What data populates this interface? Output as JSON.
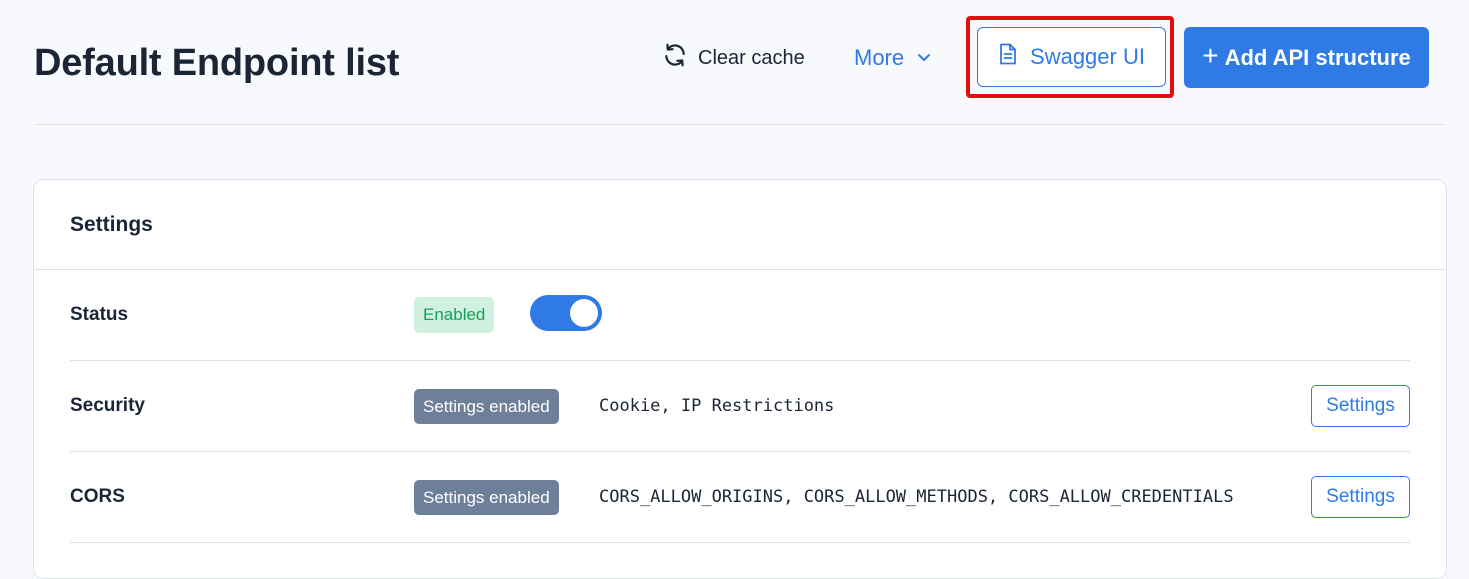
{
  "header": {
    "title": "Default Endpoint list",
    "clear_cache_label": "Clear cache",
    "more_label": "More",
    "swagger_label": "Swagger UI",
    "add_label": "Add API structure",
    "add_prefix": "+"
  },
  "settings": {
    "title": "Settings",
    "status": {
      "label": "Status",
      "badge": "Enabled",
      "toggle_on": true
    },
    "security": {
      "label": "Security",
      "badge": "Settings enabled",
      "value": "Cookie, IP Restrictions",
      "button": "Settings"
    },
    "cors": {
      "label": "CORS",
      "badge": "Settings enabled",
      "value": "CORS_ALLOW_ORIGINS, CORS_ALLOW_METHODS, CORS_ALLOW_CREDENTIALS",
      "button": "Settings"
    }
  },
  "colors": {
    "accent": "#2f7ae5",
    "highlight": "#e01010",
    "enabled_badge_bg": "#d1f1e0",
    "enabled_badge_text": "#17a05a",
    "settings_badge_bg": "#6e7f9a"
  },
  "icons": {
    "clear_cache": "refresh-icon",
    "more": "chevron-down-icon",
    "swagger": "document-icon"
  }
}
